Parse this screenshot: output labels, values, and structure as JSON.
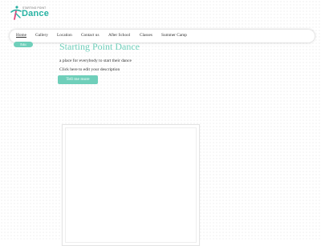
{
  "logo": {
    "word": "Dance",
    "tagline": "STARTING POINT"
  },
  "nav": {
    "items": [
      {
        "label": "Home",
        "active": true
      },
      {
        "label": "Gallery",
        "active": false
      },
      {
        "label": "Location",
        "active": false
      },
      {
        "label": "Contact us",
        "active": false
      },
      {
        "label": "After School",
        "active": false
      },
      {
        "label": "Classes",
        "active": false
      },
      {
        "label": "Summer Camp",
        "active": false
      }
    ]
  },
  "edit_label": "Edit",
  "hero": {
    "title": "Starting Point Dance",
    "tagline": "a place for everybody to start their dance",
    "description": "Click here to edit your description",
    "button_label": "Tell me more"
  },
  "colors": {
    "accent": "#6fcfba",
    "logo": "#27b3a3"
  }
}
